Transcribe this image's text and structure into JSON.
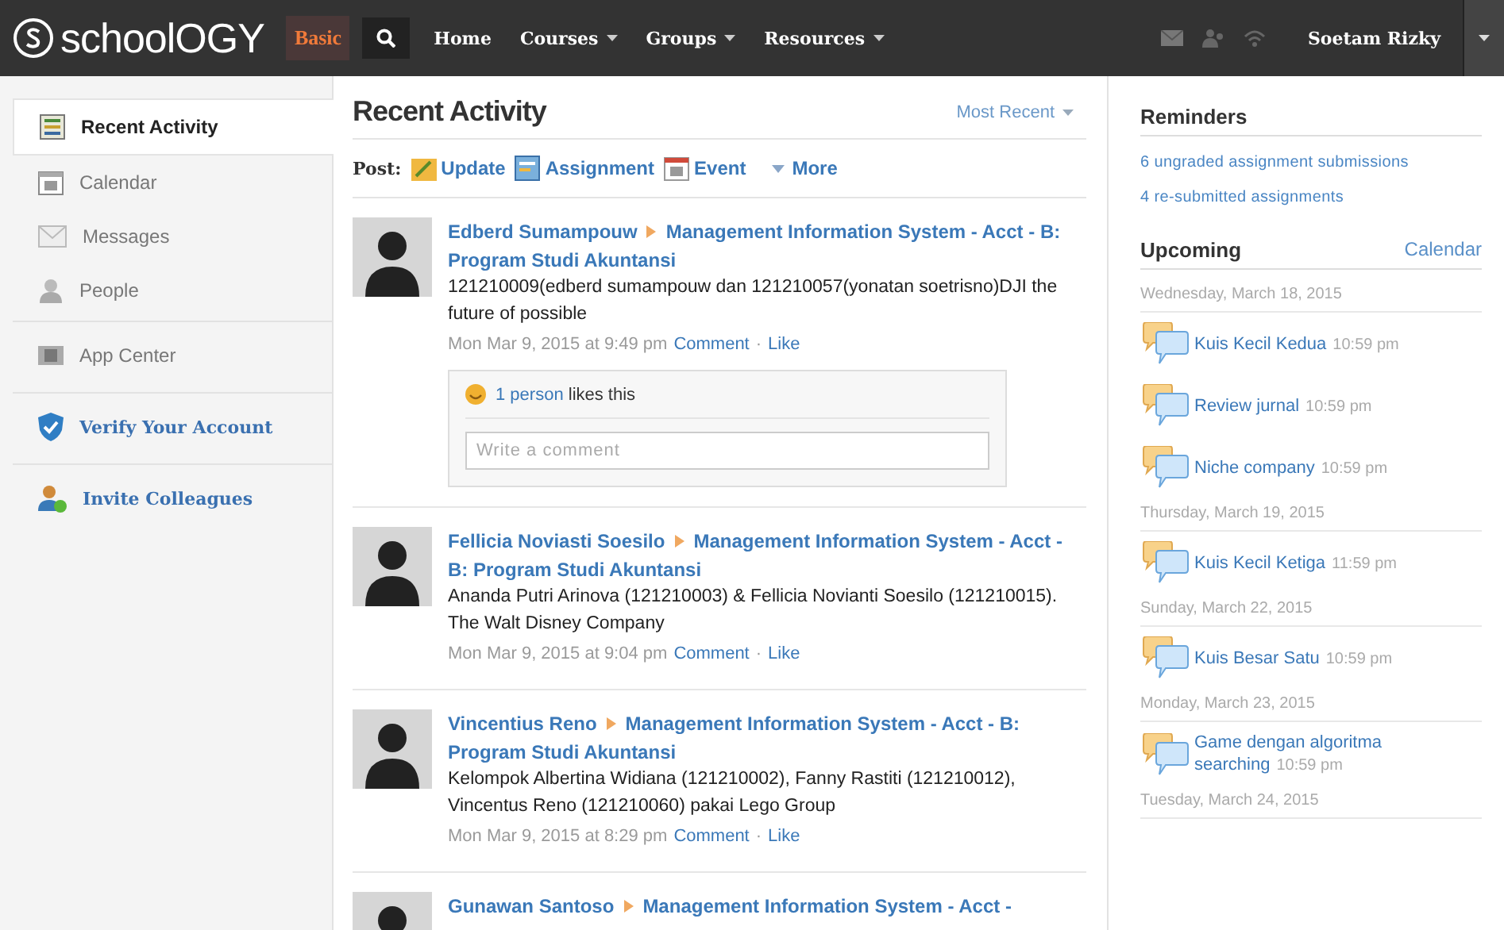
{
  "topbar": {
    "logo_text": "schoolOGY",
    "badge": "Basic",
    "nav": [
      {
        "label": "Home",
        "dropdown": false
      },
      {
        "label": "Courses",
        "dropdown": true
      },
      {
        "label": "Groups",
        "dropdown": true
      },
      {
        "label": "Resources",
        "dropdown": true
      }
    ],
    "user": "Soetam Rizky"
  },
  "sidebar": {
    "items": [
      {
        "label": "Recent Activity",
        "kind": "nav",
        "selected": true,
        "divider": false
      },
      {
        "label": "Calendar",
        "kind": "nav",
        "selected": false,
        "divider": false
      },
      {
        "label": "Messages",
        "kind": "nav",
        "selected": false,
        "divider": false
      },
      {
        "label": "People",
        "kind": "nav",
        "selected": false,
        "divider": false
      },
      {
        "label": "App Center",
        "kind": "nav",
        "selected": false,
        "divider": true
      },
      {
        "label": "Verify Your Account",
        "kind": "action",
        "selected": false,
        "divider": true
      },
      {
        "label": "Invite Colleagues",
        "kind": "action",
        "selected": false,
        "divider": true
      }
    ]
  },
  "feed": {
    "title": "Recent Activity",
    "sort": "Most Recent",
    "post_label": "Post:",
    "post_types": [
      {
        "label": "Update",
        "kind": "type"
      },
      {
        "label": "Assignment",
        "kind": "type"
      },
      {
        "label": "Event",
        "kind": "type"
      },
      {
        "label": "More",
        "kind": "menu"
      }
    ],
    "posts": [
      {
        "author": "Edberd Sumampouw",
        "course": "Management Information System - Acct - B: Program Studi Akuntansi",
        "body": "121210009(edberd sumampouw dan 121210057(yonatan soetrisno)DJI the future of possible",
        "time": "Mon Mar 9, 2015 at 9:49 pm",
        "comment": "Comment",
        "separator": "·",
        "like": "Like",
        "likes": {
          "link": "1 person",
          "text": "likes this"
        },
        "comment_placeholder": "Write a comment"
      },
      {
        "author": "Fellicia Noviasti Soesilo",
        "course": "Management Information System - Acct - B: Program Studi Akuntansi",
        "body": "Ananda Putri Arinova (121210003) & Fellicia Novianti Soesilo (121210015). The Walt Disney Company",
        "time": "Mon Mar 9, 2015 at 9:04 pm",
        "comment": "Comment",
        "separator": "·",
        "like": "Like"
      },
      {
        "author": "Vincentius Reno",
        "course": "Management Information System - Acct - B: Program Studi Akuntansi",
        "body": "Kelompok Albertina Widiana (121210002), Fanny Rastiti (121210012), Vincentus Reno (121210060) pakai Lego Group",
        "time": "Mon Mar 9, 2015 at 8:29 pm",
        "comment": "Comment",
        "separator": "·",
        "like": "Like"
      },
      {
        "author": "Gunawan Santoso",
        "course": "Management Information System - Acct -"
      }
    ]
  },
  "reminders": {
    "title": "Reminders",
    "items": [
      "6 ungraded assignment submissions",
      "4 re-submitted assignments"
    ]
  },
  "upcoming": {
    "title": "Upcoming",
    "link": "Calendar",
    "days": [
      {
        "date": "Wednesday, March 18, 2015",
        "events": [
          {
            "title": "Kuis Kecil Kedua",
            "time": "10:59 pm"
          },
          {
            "title": "Review jurnal",
            "time": "10:59 pm"
          },
          {
            "title": "Niche company",
            "time": "10:59 pm"
          }
        ]
      },
      {
        "date": "Thursday, March 19, 2015",
        "events": [
          {
            "title": "Kuis Kecil Ketiga",
            "time": "11:59 pm"
          }
        ]
      },
      {
        "date": "Sunday, March 22, 2015",
        "events": [
          {
            "title": "Kuis Besar Satu",
            "time": "10:59 pm"
          }
        ]
      },
      {
        "date": "Monday, March 23, 2015",
        "events": [
          {
            "title": "Game dengan algoritma searching",
            "time": "10:59 pm"
          }
        ]
      },
      {
        "date": "Tuesday, March 24, 2015"
      }
    ]
  }
}
